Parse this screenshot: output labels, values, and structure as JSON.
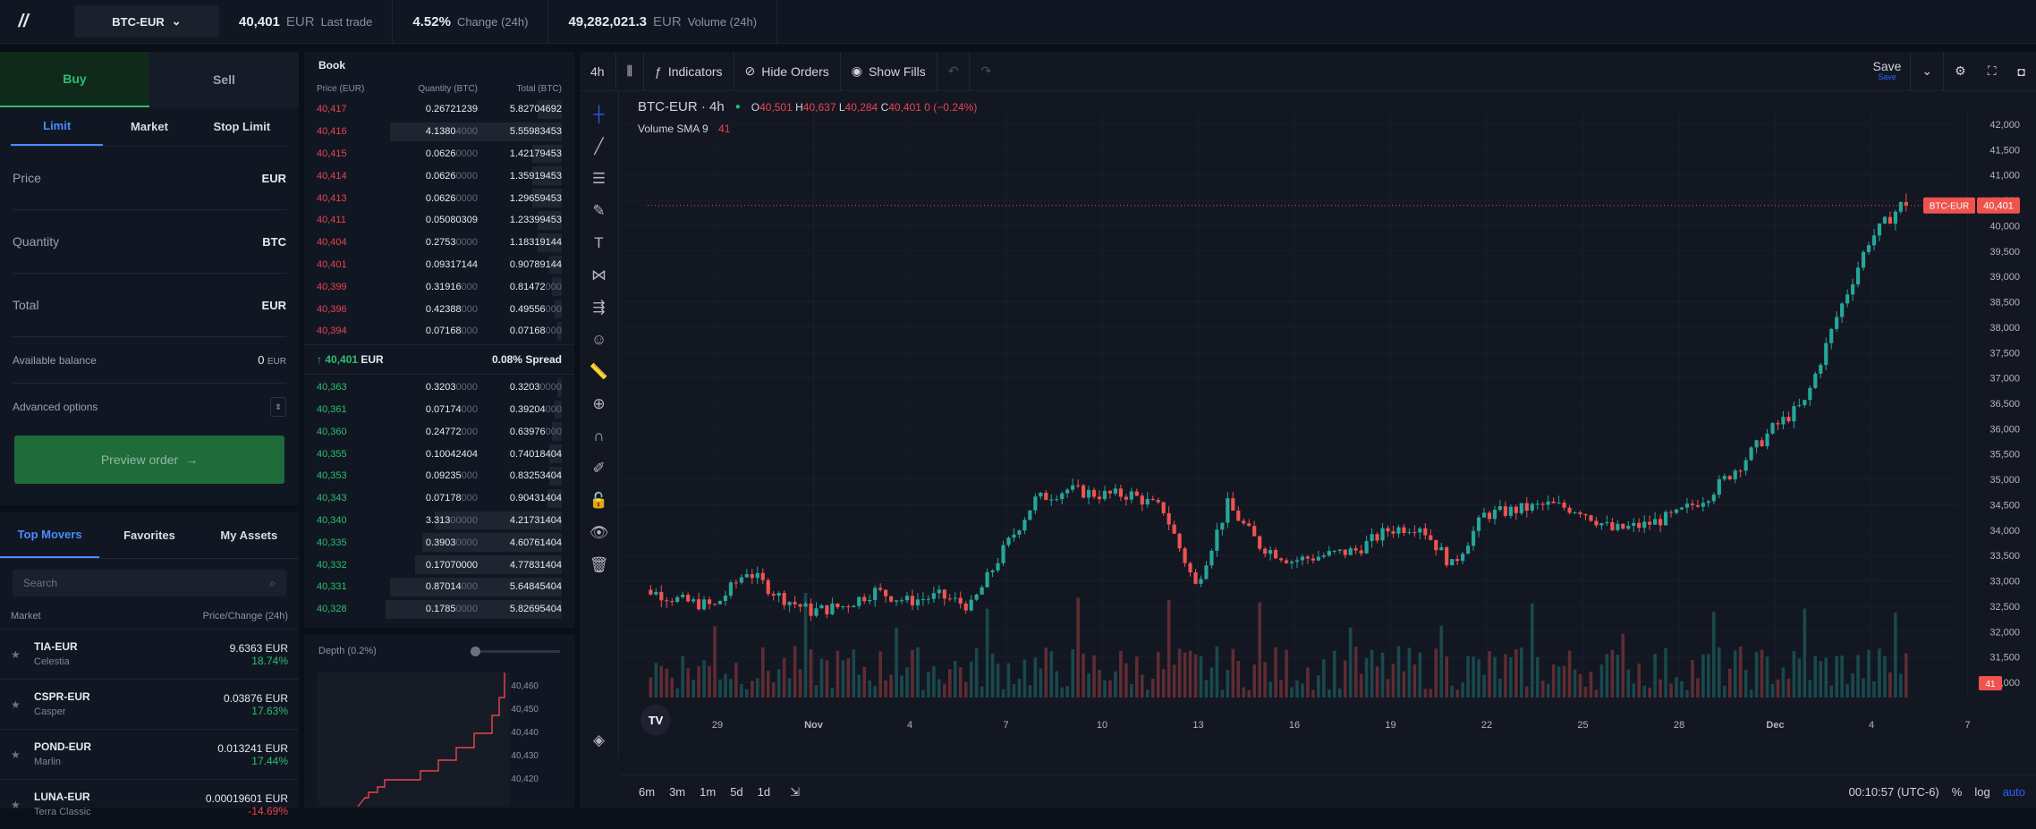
{
  "topbar": {
    "pair": "BTC-EUR",
    "last_trade": {
      "value": "40,401",
      "unit": "EUR",
      "label": "Last trade"
    },
    "change": {
      "value": "4.52%",
      "label": "Change (24h)"
    },
    "volume": {
      "value": "49,282,021.3",
      "unit": "EUR",
      "label": "Volume (24h)"
    }
  },
  "order": {
    "buy": "Buy",
    "sell": "Sell",
    "types": [
      "Limit",
      "Market",
      "Stop Limit"
    ],
    "price_label": "Price",
    "price_cur": "EUR",
    "qty_label": "Quantity",
    "qty_cur": "BTC",
    "total_label": "Total",
    "total_cur": "EUR",
    "avail_label": "Available balance",
    "avail_value": "0",
    "avail_cur": "EUR",
    "advanced": "Advanced options",
    "preview": "Preview order"
  },
  "movers": {
    "tabs": [
      "Top Movers",
      "Favorites",
      "My Assets"
    ],
    "search_placeholder": "Search",
    "col_market": "Market",
    "col_price": "Price/Change (24h)",
    "rows": [
      {
        "pair": "TIA-EUR",
        "name": "Celestia",
        "price": "9.6363 EUR",
        "change": "18.74%",
        "dir": "up"
      },
      {
        "pair": "CSPR-EUR",
        "name": "Casper",
        "price": "0.03876 EUR",
        "change": "17.63%",
        "dir": "up"
      },
      {
        "pair": "POND-EUR",
        "name": "Marlin",
        "price": "0.013241 EUR",
        "change": "17.44%",
        "dir": "up"
      },
      {
        "pair": "LUNA-EUR",
        "name": "Terra Classic",
        "price": "0.00019601 EUR",
        "change": "-14.69%",
        "dir": "down"
      }
    ]
  },
  "book": {
    "title": "Book",
    "col_price": "Price (EUR)",
    "col_qty": "Quantity (BTC)",
    "col_total": "Total (BTC)",
    "asks": [
      {
        "p": "40,417",
        "q": [
          "0.",
          "26721239"
        ],
        "t": [
          "5.",
          "82704692"
        ],
        "w": 0.1
      },
      {
        "p": "40,416",
        "q": [
          "4.",
          "1380",
          "4000"
        ],
        "t": [
          "5.",
          "55983453"
        ],
        "w": 0.7
      },
      {
        "p": "40,415",
        "q": [
          "0.",
          "0626",
          "0000"
        ],
        "t": [
          "1.",
          "42179453"
        ],
        "w": 0.12
      },
      {
        "p": "40,414",
        "q": [
          "0.",
          "0626",
          "0000"
        ],
        "t": [
          "1.",
          "35919453"
        ],
        "w": 0.12
      },
      {
        "p": "40,413",
        "q": [
          "0.",
          "0626",
          "0000"
        ],
        "t": [
          "1.",
          "29659453"
        ],
        "w": 0.12
      },
      {
        "p": "40,411",
        "q": [
          "0.",
          "05080309"
        ],
        "t": [
          "1.",
          "23399453"
        ],
        "w": 0.1
      },
      {
        "p": "40,404",
        "q": [
          "0.",
          "2753",
          "0000"
        ],
        "t": [
          "1.",
          "18319144"
        ],
        "w": 0.1
      },
      {
        "p": "40,401",
        "q": [
          "0.",
          "09317144"
        ],
        "t": [
          "0.",
          "90789144"
        ],
        "w": 0.05
      },
      {
        "p": "40,399",
        "q": [
          "0.",
          "31916",
          "000"
        ],
        "t": [
          "0.",
          "81472",
          "000"
        ],
        "w": 0.04
      },
      {
        "p": "40,396",
        "q": [
          "0.",
          "42388",
          "000"
        ],
        "t": [
          "0.",
          "49556",
          "000"
        ],
        "w": 0.03
      },
      {
        "p": "40,394",
        "q": [
          "0.",
          "07168",
          "000"
        ],
        "t": [
          "0.",
          "07168",
          "000"
        ],
        "w": 0.02
      }
    ],
    "mid_price": "40,401",
    "mid_cur": "EUR",
    "spread": "0.08% Spread",
    "bids": [
      {
        "p": "40,363",
        "q": [
          "0.",
          "3203",
          "0000"
        ],
        "t": [
          "0.",
          "3203",
          "0000"
        ],
        "w": 0.02
      },
      {
        "p": "40,361",
        "q": [
          "0.",
          "07174",
          "000"
        ],
        "t": [
          "0.",
          "39204",
          "000"
        ],
        "w": 0.03
      },
      {
        "p": "40,360",
        "q": [
          "0.",
          "24772",
          "000"
        ],
        "t": [
          "0.",
          "63976",
          "000"
        ],
        "w": 0.04
      },
      {
        "p": "40,355",
        "q": [
          "0.",
          "10042404"
        ],
        "t": [
          "0.",
          "74018404"
        ],
        "w": 0.05
      },
      {
        "p": "40,353",
        "q": [
          "0.",
          "09235",
          "000"
        ],
        "t": [
          "0.",
          "83253404"
        ],
        "w": 0.05
      },
      {
        "p": "40,343",
        "q": [
          "0.",
          "07178",
          "000"
        ],
        "t": [
          "0.",
          "90431404"
        ],
        "w": 0.06
      },
      {
        "p": "40,340",
        "q": [
          "3.",
          "313",
          "00000"
        ],
        "t": [
          "4.",
          "21731404"
        ],
        "w": 0.52
      },
      {
        "p": "40,335",
        "q": [
          "0.",
          "3903",
          "0000"
        ],
        "t": [
          "4.",
          "60761404"
        ],
        "w": 0.57
      },
      {
        "p": "40,332",
        "q": [
          "0.",
          "17070000"
        ],
        "t": [
          "4.",
          "77831404"
        ],
        "w": 0.6
      },
      {
        "p": "40,331",
        "q": [
          "0.",
          "87014",
          "000"
        ],
        "t": [
          "5.",
          "64845404"
        ],
        "w": 0.7
      },
      {
        "p": "40,328",
        "q": [
          "0.",
          "1785",
          "0000"
        ],
        "t": [
          "5.",
          "82695404"
        ],
        "w": 0.72
      }
    ]
  },
  "depth": {
    "title": "Depth",
    "pct": "(0.2%)",
    "ticks": [
      "40,460",
      "40,450",
      "40,440",
      "40,430",
      "40,420"
    ]
  },
  "chart_toolbar": {
    "interval": "4h",
    "indicators": "Indicators",
    "hide_orders": "Hide Orders",
    "show_fills": "Show Fills",
    "save": "Save",
    "save_sub": "Save"
  },
  "chart_legend": {
    "symbol": "BTC-EUR · 4h",
    "o_label": "O",
    "o": "40,501",
    "h_label": "H",
    "h": "40,637",
    "l_label": "L",
    "l": "40,284",
    "c_label": "C",
    "c": "40,401",
    "chg": "0 (−0.24%)",
    "vol_label": "Volume SMA 9",
    "vol_value": "41"
  },
  "chart_bottom": {
    "ranges": [
      "6m",
      "3m",
      "1m",
      "5d",
      "1d"
    ],
    "clock": "00:10:57 (UTC-6)",
    "pct": "%",
    "log": "log",
    "auto": "auto"
  },
  "chart_data": {
    "type": "candlestick",
    "symbol": "BTC-EUR",
    "interval": "4h",
    "y_ticks": [
      42000,
      41500,
      41000,
      40500,
      40000,
      39500,
      39000,
      38500,
      38000,
      37500,
      37000,
      36500,
      36000,
      35500,
      35000,
      34500,
      34000,
      33500,
      33000,
      32500,
      32000,
      31500,
      31000
    ],
    "ylim": [
      30700,
      42300
    ],
    "x_tick_labels": [
      "29",
      "Nov",
      "4",
      "7",
      "10",
      "13",
      "16",
      "19",
      "22",
      "25",
      "28",
      "Dec",
      "4",
      "7"
    ],
    "last_price": 40401,
    "last_price_label": "BTC-EUR",
    "volume_sma_value": "41",
    "close_path": [
      [
        "Oct 27",
        32700
      ],
      [
        "Oct 28",
        32800
      ],
      [
        "Oct 29",
        32600
      ],
      [
        "Oct 30",
        32500
      ],
      [
        "Oct 31",
        33200
      ],
      [
        "Nov 1",
        32700
      ],
      [
        "Nov 2",
        32400
      ],
      [
        "Nov 3",
        32500
      ],
      [
        "Nov 4",
        32800
      ],
      [
        "Nov 5",
        32600
      ],
      [
        "Nov 6",
        32700
      ],
      [
        "Nov 7",
        32500
      ],
      [
        "Nov 8",
        33600
      ],
      [
        "Nov 9",
        34600
      ],
      [
        "Nov 10",
        34800
      ],
      [
        "Nov 11",
        34700
      ],
      [
        "Nov 12",
        34700
      ],
      [
        "Nov 13",
        34400
      ],
      [
        "Nov 14",
        32900
      ],
      [
        "Nov 15",
        34500
      ],
      [
        "Nov 16",
        33700
      ],
      [
        "Nov 17",
        33400
      ],
      [
        "Nov 18",
        33500
      ],
      [
        "Nov 19",
        33600
      ],
      [
        "Nov 20",
        34000
      ],
      [
        "Nov 21",
        34100
      ],
      [
        "Nov 22",
        33300
      ],
      [
        "Nov 23",
        34300
      ],
      [
        "Nov 24",
        34400
      ],
      [
        "Nov 25",
        34500
      ],
      [
        "Nov 26",
        34400
      ],
      [
        "Nov 27",
        34000
      ],
      [
        "Nov 28",
        34100
      ],
      [
        "Nov 29",
        34300
      ],
      [
        "Nov 30",
        34700
      ],
      [
        "Dec 1",
        35300
      ],
      [
        "Dec 2",
        36000
      ],
      [
        "Dec 3",
        36500
      ],
      [
        "Dec 4",
        38200
      ],
      [
        "Dec 5",
        39700
      ],
      [
        "Dec 6",
        40401
      ]
    ]
  }
}
